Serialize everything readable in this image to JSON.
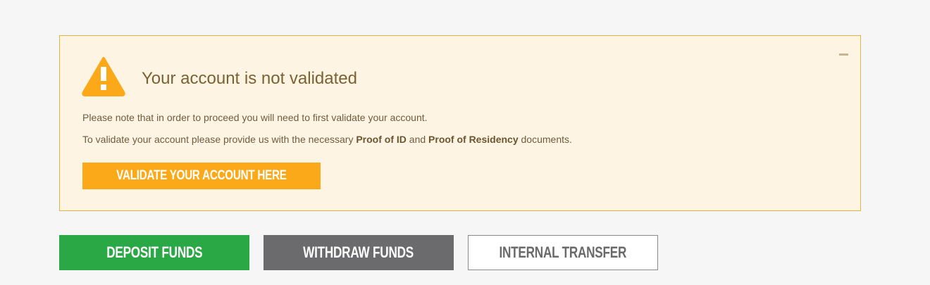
{
  "alert": {
    "title": "Your account is not validated",
    "line1": "Please note that in order to proceed you will need to first validate your account.",
    "line2_prefix": "To validate your account please provide us with the necessary ",
    "line2_bold1": "Proof of ID",
    "line2_mid": " and ",
    "line2_bold2": "Proof of Residency",
    "line2_suffix": " documents.",
    "button_label": "VALIDATE YOUR ACCOUNT HERE",
    "icon": "warning-triangle-icon",
    "collapse_icon": "minus-icon"
  },
  "actions": {
    "deposit_label": "DEPOSIT FUNDS",
    "withdraw_label": "WITHDRAW FUNDS",
    "transfer_label": "INTERNAL TRANSFER"
  },
  "colors": {
    "background": "#f6f6f6",
    "alert_background": "#fdf4e3",
    "alert_border": "#e3b43f",
    "warning": "#fba919",
    "deposit": "#2aa845",
    "withdraw": "#6b6b6d",
    "transfer_border": "#8a8a8a"
  }
}
